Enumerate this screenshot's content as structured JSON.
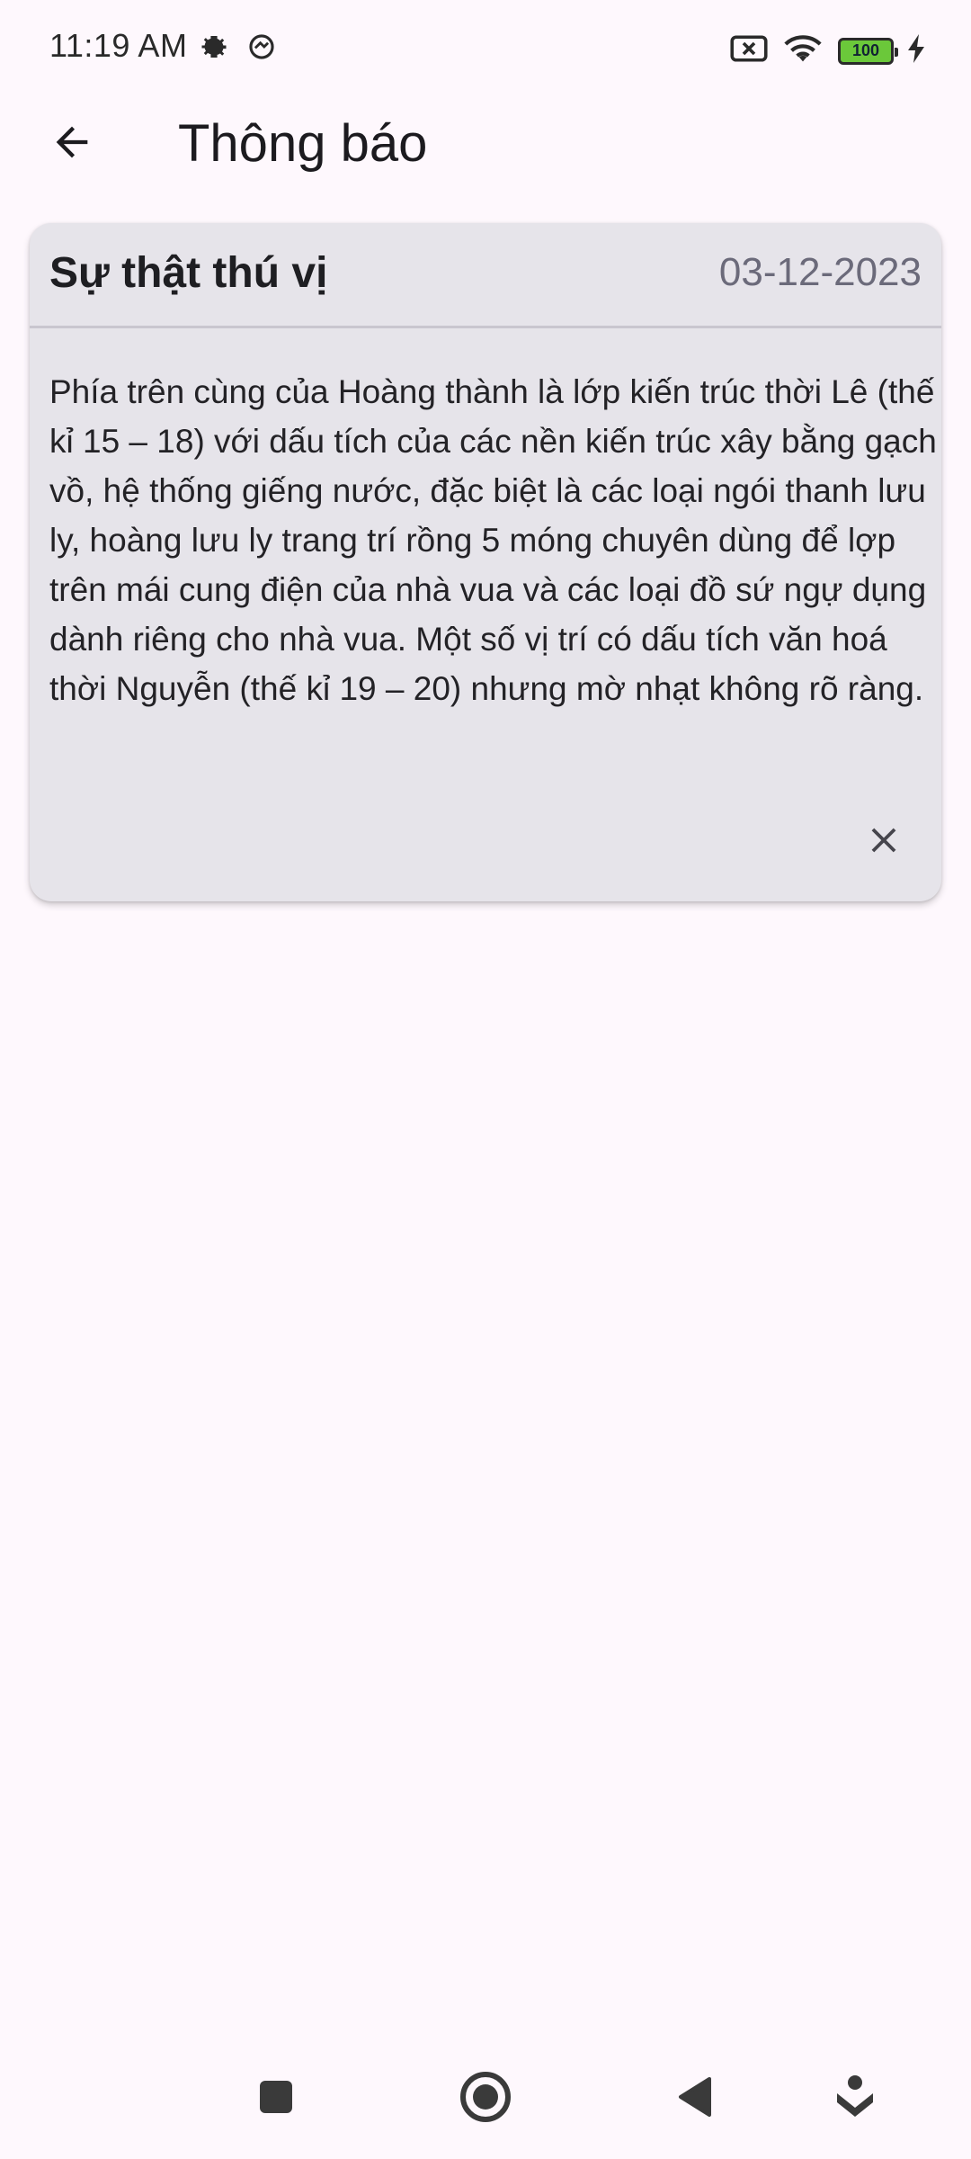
{
  "status_bar": {
    "time": "11:19 AM",
    "battery_level": "100",
    "icons": [
      "settings-gear-icon",
      "vpn-icon",
      "no-sim-icon",
      "wifi-icon",
      "battery-icon",
      "charging-bolt-icon"
    ],
    "battery_color": "#6bc83a"
  },
  "app_bar": {
    "title": "Thông báo",
    "back_icon": "arrow-left-icon"
  },
  "notification": {
    "title": "Sự thật thú vị",
    "date": "03-12-2023",
    "body": "Phía trên cùng của Hoàng thành là lớp kiến trúc thời Lê (thế kỉ 15 – 18) với dấu tích của các nền kiến trúc xây bằng gạch vồ, hệ thống giếng nước, đặc biệt là các loại ngói thanh lưu ly, hoàng lưu ly trang trí rồng 5 móng chuyên dùng để lợp trên mái cung điện của nhà vua và các loại đồ sứ ngự dụng dành riêng cho nhà vua. Một số vị trí có dấu tích văn hoá thời Nguyễn (thế kỉ 19 – 20) nhưng mờ nhạt không rõ ràng.",
    "close_icon": "close-icon"
  },
  "nav_bar": {
    "buttons": [
      "recents-square-icon",
      "home-circle-icon",
      "back-triangle-icon",
      "assistant-icon"
    ]
  },
  "colors": {
    "background": "#fef8fd",
    "card": "#e6e4ea",
    "date_text": "#6b6a7a"
  }
}
